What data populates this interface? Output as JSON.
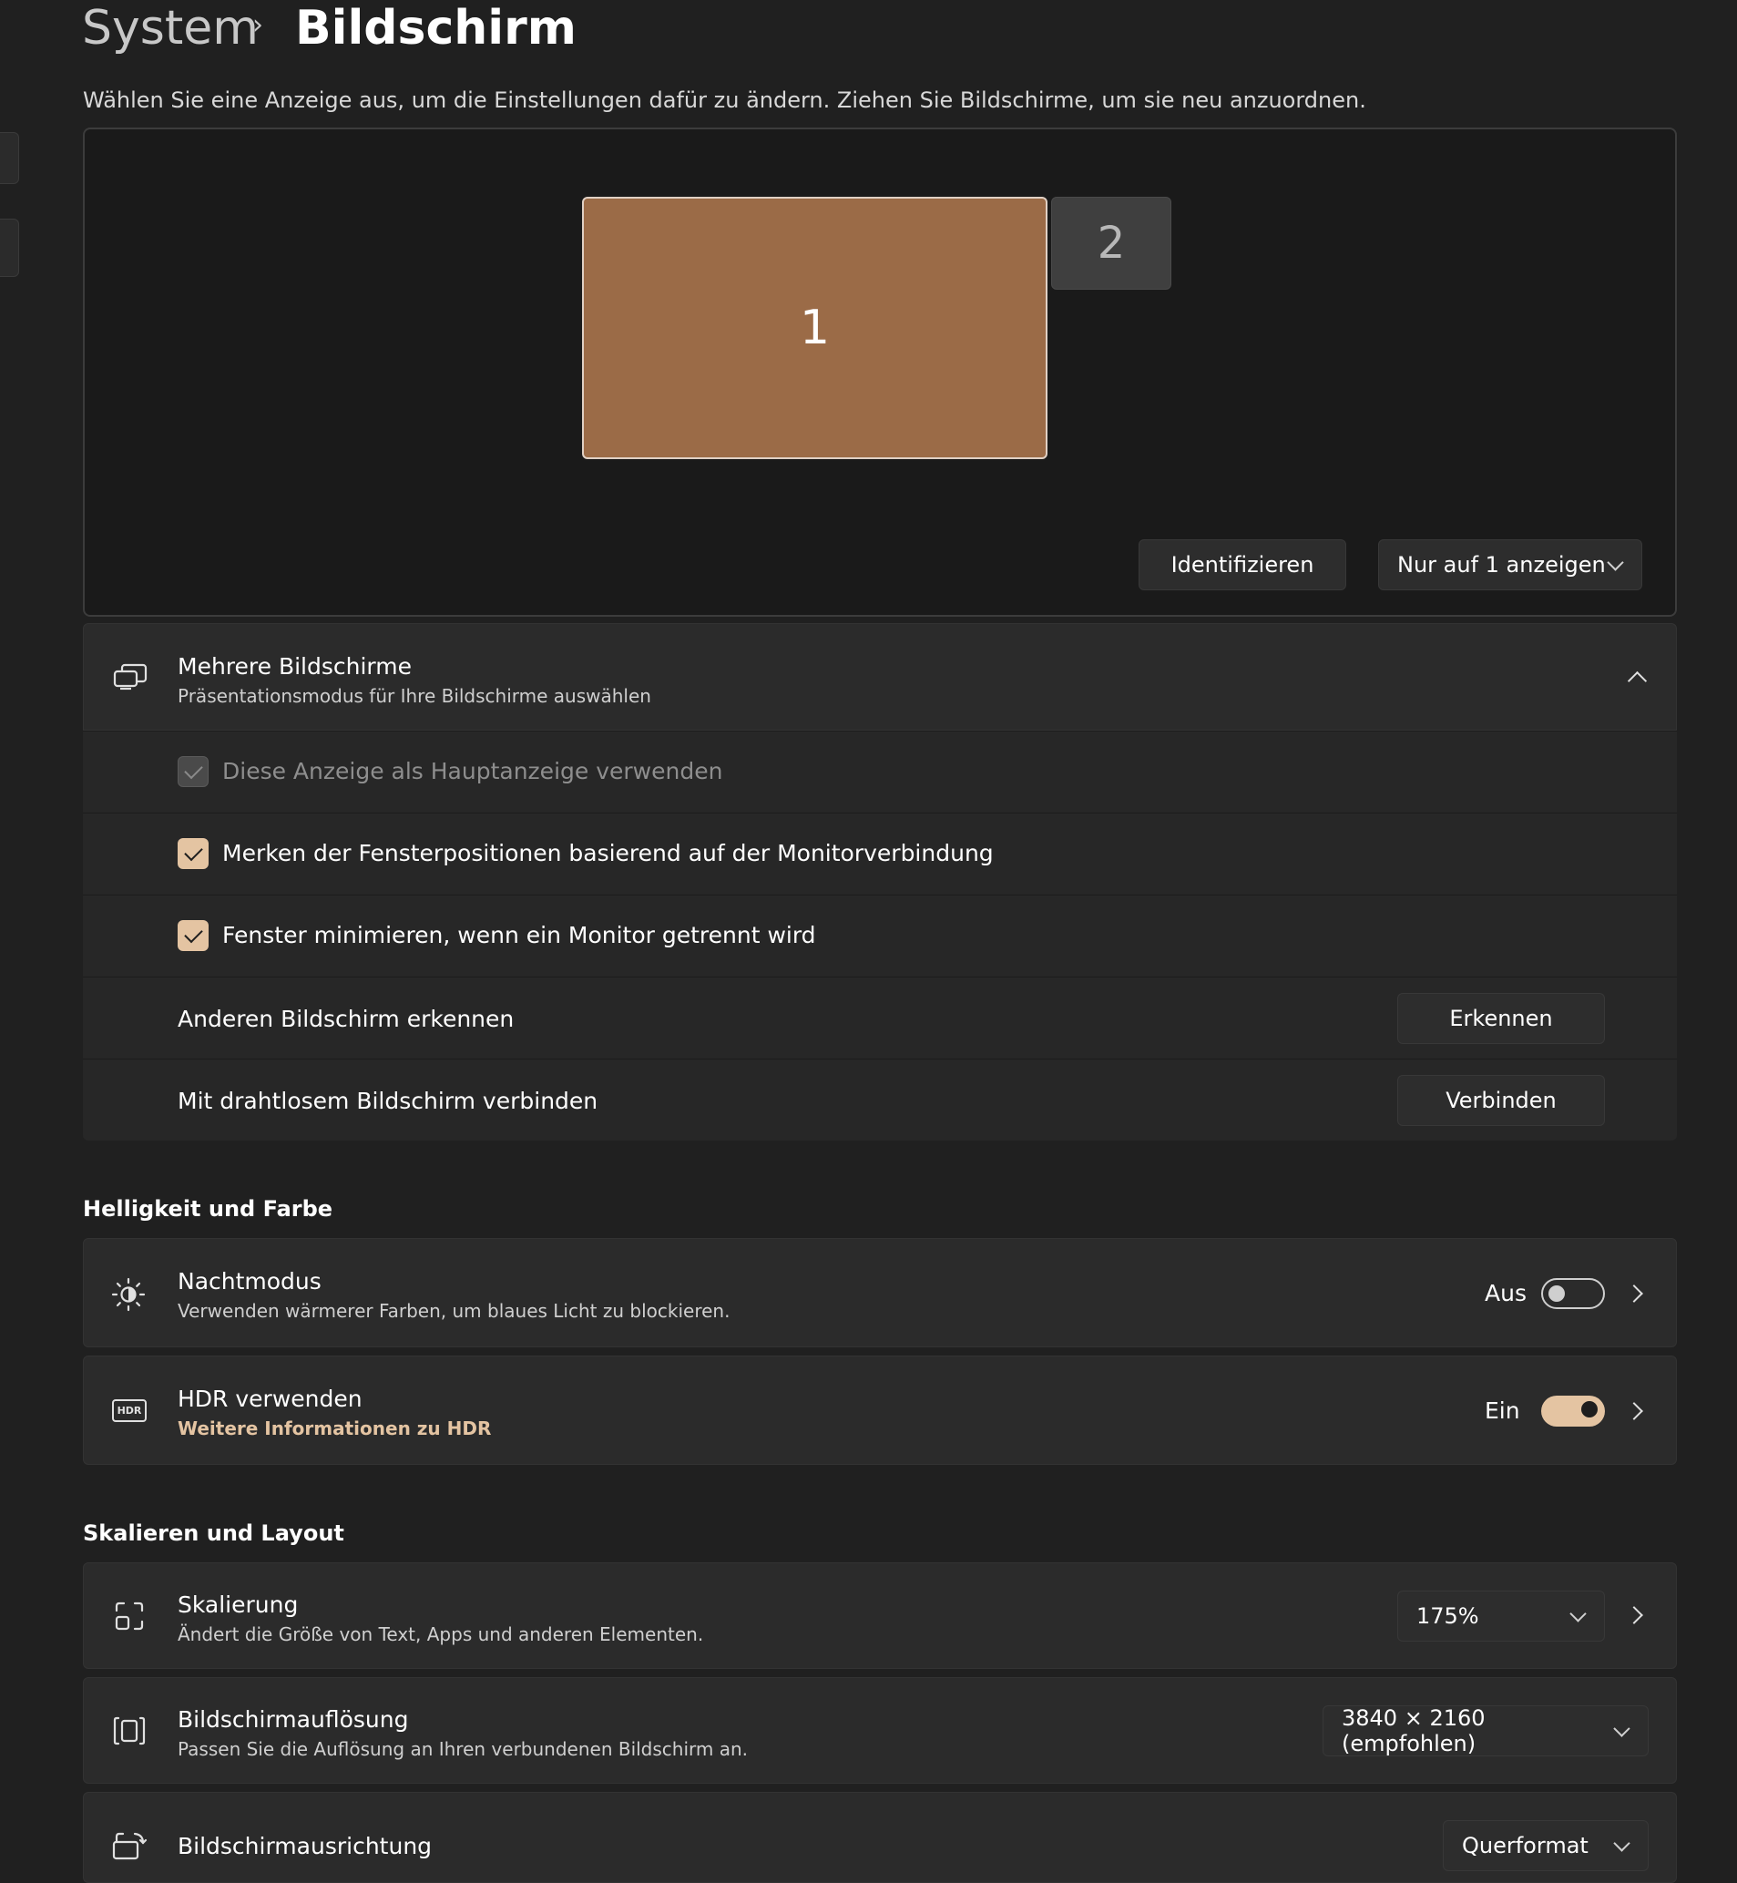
{
  "breadcrumb": {
    "parent": "System",
    "separator": "›",
    "current": "Bildschirm"
  },
  "instruction": "Wählen Sie eine Anzeige aus, um die Einstellungen dafür zu ändern. Ziehen Sie Bildschirme, um sie neu anzuordnen.",
  "arrangement": {
    "monitors": [
      {
        "label": "1",
        "selected": true
      },
      {
        "label": "2",
        "selected": false
      }
    ],
    "identify_label": "Identifizieren",
    "mode_dropdown": {
      "value": "Nur auf 1 anzeigen"
    }
  },
  "multi": {
    "title": "Mehrere Bildschirme",
    "subtitle": "Präsentationsmodus für Ihre Bildschirme auswählen",
    "expanded": true,
    "options": [
      {
        "label": "Diese Anzeige als Hauptanzeige verwenden",
        "checked": true,
        "disabled": true
      },
      {
        "label": "Merken der Fensterpositionen basierend auf der Monitorverbindung",
        "checked": true,
        "disabled": false
      },
      {
        "label": "Fenster minimieren, wenn ein Monitor getrennt wird",
        "checked": true,
        "disabled": false
      }
    ],
    "detect": {
      "label": "Anderen Bildschirm erkennen",
      "button": "Erkennen"
    },
    "wireless": {
      "label": "Mit drahtlosem Bildschirm verbinden",
      "button": "Verbinden"
    }
  },
  "brightness": {
    "heading": "Helligkeit und Farbe",
    "night": {
      "title": "Nachtmodus",
      "subtitle": "Verwenden wärmerer Farben, um blaues Licht zu blockieren.",
      "state_label": "Aus",
      "on": false
    },
    "hdr": {
      "title": "HDR verwenden",
      "link": "Weitere Informationen zu HDR",
      "state_label": "Ein",
      "on": true,
      "icon_text": "HDR"
    }
  },
  "scale": {
    "heading": "Skalieren und Layout",
    "scaling": {
      "title": "Skalierung",
      "subtitle": "Ändert die Größe von Text, Apps und anderen Elementen.",
      "value": "175%"
    },
    "resolution": {
      "title": "Bildschirmauflösung",
      "subtitle": "Passen Sie die Auflösung an Ihren verbundenen Bildschirm an.",
      "value": "3840 × 2160 (empfohlen)"
    },
    "orientation": {
      "title": "Bildschirmausrichtung",
      "value": "Querformat"
    }
  },
  "colors": {
    "accent": "#e4c4a2",
    "selected_monitor": "#9b6b47",
    "background": "#202020",
    "card": "#2b2b2b"
  }
}
